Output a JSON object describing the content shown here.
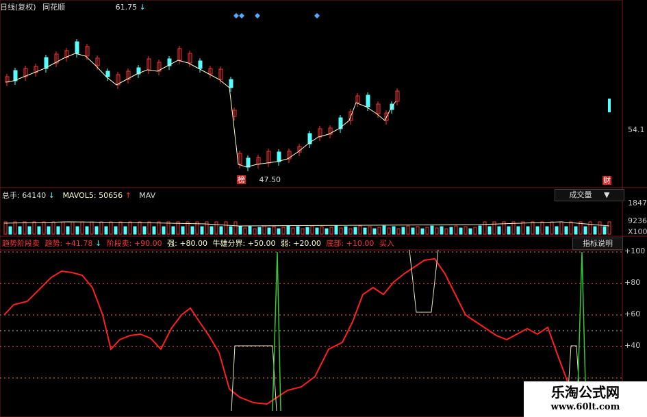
{
  "header": {
    "period": "日线(复权)",
    "source": "同花顺",
    "last_value": "61.75",
    "last_arrow": "↓"
  },
  "price": {
    "low_label": "47.50",
    "low_marker": "榜",
    "right_axis": "54.1",
    "fin_marker": "财",
    "color_up": "#ff3333",
    "color_down": "#55ffff",
    "color_ma": "#ffffcc"
  },
  "volume": {
    "label_total": "总手:",
    "total": "64140",
    "total_arrow": "↓",
    "label_mavol": "MAVOL5:",
    "mavol": "50656",
    "mavol_arrow": "↑",
    "label_mav": "MAV",
    "dropdown": "成交量",
    "axis_top": "1847",
    "axis_mid": "9236",
    "axis_unit": "X100"
  },
  "indicator": {
    "name": "趋势阶段卖",
    "trend_label": "趋势:",
    "trend_value": "+41.78",
    "trend_arrow": "↓",
    "stage_label": "阶段卖:",
    "stage_value": "+90.00",
    "strong_label": "强:",
    "strong_value": "+80.00",
    "bull_label": "牛雄分界:",
    "bull_value": "+50.00",
    "weak_label": "弱:",
    "weak_value": "+20.00",
    "bottom_label": "底部:",
    "bottom_value": "+10.00",
    "buy_label": "买入",
    "explain_button": "指标说明",
    "axis": [
      "+100",
      "+80",
      "+60",
      "+40"
    ],
    "color_trend": "#ff2020",
    "color_buy": "#33cc33"
  },
  "watermark": {
    "title": "乐淘公式网",
    "url": "www.60lt.com"
  }
}
